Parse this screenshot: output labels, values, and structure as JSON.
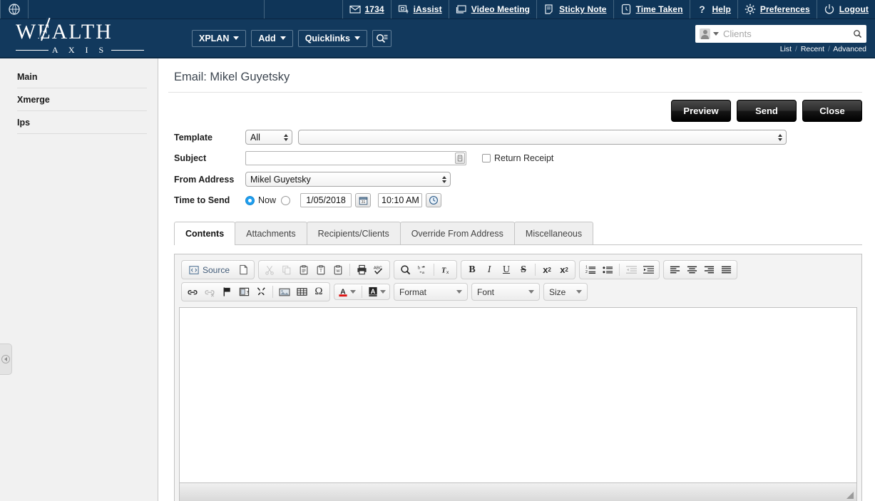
{
  "topbar": {
    "globe_icon": "globe-icon",
    "items": [
      {
        "icon": "envelope-icon",
        "label": "1734"
      },
      {
        "icon": "iassist-icon",
        "label": "iAssist"
      },
      {
        "icon": "monitor-icon",
        "label": "Video Meeting"
      },
      {
        "icon": "note-icon",
        "label": "Sticky Note"
      },
      {
        "icon": "clock-icon",
        "label": "Time Taken"
      },
      {
        "icon": "question-icon",
        "label": "Help"
      },
      {
        "icon": "gear-icon",
        "label": "Preferences"
      },
      {
        "icon": "power-icon",
        "label": "Logout"
      }
    ]
  },
  "brand": {
    "name_main": "WEALTH",
    "name_sub": "A X I S",
    "nav": [
      {
        "label": "XPLAN"
      },
      {
        "label": "Add"
      },
      {
        "label": "Quicklinks"
      }
    ],
    "nav_search_icon": "search-list-icon"
  },
  "search": {
    "placeholder": "Clients",
    "avatar_icon": "person-icon",
    "search_icon": "search-icon",
    "links": [
      "List",
      "Recent",
      "Advanced"
    ]
  },
  "sidebar": {
    "items": [
      {
        "label": "Main"
      },
      {
        "label": "Xmerge"
      },
      {
        "label": "Ips"
      }
    ],
    "collapse_icon": "collapse-left-icon"
  },
  "page": {
    "title": "Email: Mikel Guyetsky"
  },
  "actions": {
    "preview": "Preview",
    "send": "Send",
    "close": "Close"
  },
  "form": {
    "template_label": "Template",
    "template_filter_value": "All",
    "template_value": "",
    "subject_label": "Subject",
    "subject_value": "",
    "return_receipt_label": "Return Receipt",
    "from_label": "From Address",
    "from_value": "Mikel Guyetsky",
    "time_label": "Time to Send",
    "now_label": "Now",
    "date_value": "1/05/2018",
    "time_value": "10:10 AM",
    "calendar_icon": "calendar-icon",
    "clock_picker_icon": "clock-icon"
  },
  "tabs": [
    {
      "label": "Contents",
      "active": true
    },
    {
      "label": "Attachments",
      "active": false
    },
    {
      "label": "Recipients/Clients",
      "active": false
    },
    {
      "label": "Override From Address",
      "active": false
    },
    {
      "label": "Miscellaneous",
      "active": false
    }
  ],
  "editor": {
    "source_label": "Source",
    "format_label": "Format",
    "font_label": "Font",
    "size_label": "Size",
    "content": "",
    "tools_row1": [
      "source-button",
      "new-page-icon",
      "cut-icon",
      "copy-icon",
      "paste-icon",
      "paste-text-icon",
      "paste-word-icon",
      "print-icon",
      "spellcheck-icon",
      "find-icon",
      "replace-icon",
      "remove-format-icon",
      "bold-icon",
      "italic-icon",
      "underline-icon",
      "strikethrough-icon",
      "subscript-icon",
      "superscript-icon",
      "numbered-list-icon",
      "bulleted-list-icon",
      "outdent-icon",
      "indent-icon",
      "align-left-icon",
      "align-center-icon",
      "align-right-icon",
      "align-justify-icon"
    ],
    "tools_row2": [
      "link-icon",
      "unlink-icon",
      "anchor-icon",
      "merge-field-icon",
      "scissors-icon",
      "image-icon",
      "table-icon",
      "special-char-icon",
      "text-color-icon",
      "background-color-icon"
    ]
  },
  "colors": {
    "header_dark": "#0f3558",
    "brand_blue": "#12395d",
    "accent_blue": "#1f9ff0",
    "sidebar_bg": "#f1f1f1"
  }
}
